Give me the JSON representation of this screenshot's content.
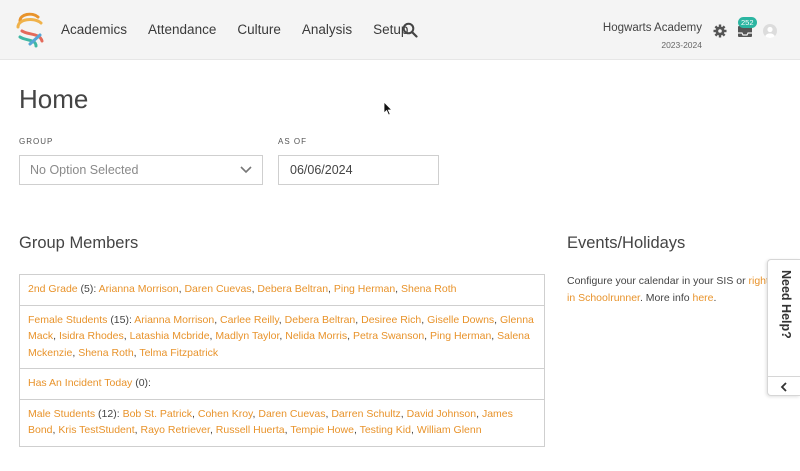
{
  "nav": {
    "items": [
      {
        "name": "nav-academics",
        "label": "Academics"
      },
      {
        "name": "nav-attendance",
        "label": "Attendance"
      },
      {
        "name": "nav-culture",
        "label": "Culture"
      },
      {
        "name": "nav-analysis",
        "label": "Analysis"
      },
      {
        "name": "nav-setup",
        "label": "Setup"
      }
    ],
    "school_name": "Hogwarts Academy",
    "school_year": "2023-2024",
    "inbox_count": "252",
    "icons": [
      "logo-icon",
      "search-icon",
      "gear-icon",
      "inbox-icon",
      "avatar-icon"
    ]
  },
  "page": {
    "title": "Home"
  },
  "filters": {
    "group_label": "GROUP",
    "group_value": "No Option Selected",
    "asof_label": "AS OF",
    "asof_value": "06/06/2024"
  },
  "group_members": {
    "title": "Group Members",
    "groups": [
      {
        "name": "2nd Grade",
        "count": "(5):",
        "members": [
          "Arianna Morrison",
          "Daren Cuevas",
          "Debera Beltran",
          "Ping Herman",
          "Shena Roth"
        ]
      },
      {
        "name": "Female Students",
        "count": "(15):",
        "members": [
          "Arianna Morrison",
          "Carlee Reilly",
          "Debera Beltran",
          "Desiree Rich",
          "Giselle Downs",
          "Glenna Mack",
          "Isidra Rhodes",
          "Latashia Mcbride",
          "Madlyn Taylor",
          "Nelida Morris",
          "Petra Swanson",
          "Ping Herman",
          "Salena Mckenzie",
          "Shena Roth",
          "Telma Fitzpatrick"
        ]
      },
      {
        "name": "Has An Incident Today",
        "count": "(0):",
        "members": []
      },
      {
        "name": "Male Students",
        "count": "(12):",
        "members": [
          "Bob St. Patrick",
          "Cohen Kroy",
          "Daren Cuevas",
          "Darren Schultz",
          "David Johnson",
          "James Bond",
          "Kris TestStudent",
          "Rayo Retriever",
          "Russell Huerta",
          "Tempie Howe",
          "Testing Kid",
          "William Glenn"
        ]
      }
    ]
  },
  "events": {
    "title": "Events/Holidays",
    "line1_text": "Configure your calendar in your SIS or ",
    "line1_link": "right",
    "line2_link": "in Schoolrunner",
    "line2_text": ". More info ",
    "line2_link2": "here",
    "line2_end": "."
  },
  "help": {
    "label": "Need Help?"
  },
  "colors": {
    "accent": "#e8932b",
    "badge": "#2bb5a1"
  }
}
